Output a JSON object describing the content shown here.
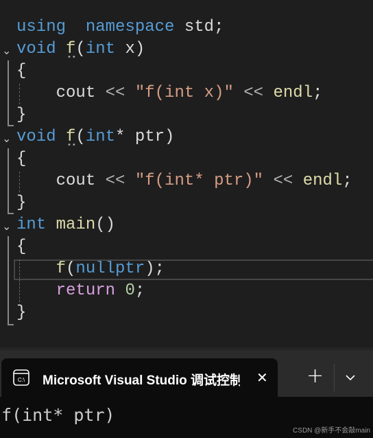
{
  "code_lines": [
    [
      [
        "kw",
        "using"
      ],
      [
        "",
        "  "
      ],
      [
        "kw",
        "namespace"
      ],
      [
        "",
        "",
        " std;"
      ]
    ],
    [
      [
        "kw",
        "void"
      ],
      [
        "",
        " "
      ],
      [
        "fn",
        "f"
      ],
      [
        "",
        "("
      ],
      [
        "kw",
        "int"
      ],
      [
        "",
        " x)"
      ]
    ],
    [
      [
        "",
        "{"
      ]
    ],
    [
      [
        "",
        "    cout "
      ],
      [
        "op",
        "<<"
      ],
      [
        "",
        " "
      ],
      [
        "str",
        "\"f(int x)\""
      ],
      [
        "",
        " "
      ],
      [
        "op",
        "<<"
      ],
      [
        "",
        " "
      ],
      [
        "fn",
        "endl"
      ],
      [
        "",
        ";"
      ]
    ],
    [
      [
        "",
        "}"
      ]
    ],
    [
      [
        "kw",
        "void"
      ],
      [
        "",
        " "
      ],
      [
        "fn",
        "f"
      ],
      [
        "",
        "("
      ],
      [
        "kw",
        "int"
      ],
      [
        "",
        "* ptr)"
      ]
    ],
    [
      [
        "",
        "{"
      ]
    ],
    [
      [
        "",
        "    cout "
      ],
      [
        "op",
        "<<"
      ],
      [
        "",
        " "
      ],
      [
        "str",
        "\"f(int* ptr)\""
      ],
      [
        "",
        " "
      ],
      [
        "op",
        "<<"
      ],
      [
        "",
        " "
      ],
      [
        "fn",
        "endl"
      ],
      [
        "",
        ";"
      ]
    ],
    [
      [
        "",
        "}"
      ]
    ],
    [
      [
        "kw",
        "int"
      ],
      [
        "",
        " "
      ],
      [
        "fn",
        "main"
      ],
      [
        "",
        "()"
      ]
    ],
    [
      [
        "",
        "{"
      ]
    ],
    [
      [
        "",
        "    "
      ],
      [
        "fn",
        "f"
      ],
      [
        "",
        "("
      ],
      [
        "kw",
        "nullptr"
      ],
      [
        "",
        ");"
      ]
    ],
    [
      [
        "",
        "    "
      ],
      [
        "ctl",
        "return"
      ],
      [
        "",
        " "
      ],
      [
        "num",
        "0"
      ],
      [
        "",
        ";"
      ]
    ],
    [
      [
        "",
        "}"
      ]
    ]
  ],
  "terminal": {
    "tab_title": "Microsoft Visual Studio 调试控制台",
    "tab_icon": "terminal-icon",
    "output": "f(int* ptr)",
    "new_tab_symbol": "+",
    "dropdown_symbol": "⌄",
    "close_symbol": "✕",
    "icon_text": "C:\\"
  },
  "watermark": "CSDN @新手不会敲main",
  "colors": {
    "keyword": "#569cd6",
    "function": "#dcdcaa",
    "string": "#d69d85",
    "control": "#d8a0df",
    "number": "#b5cea8"
  }
}
